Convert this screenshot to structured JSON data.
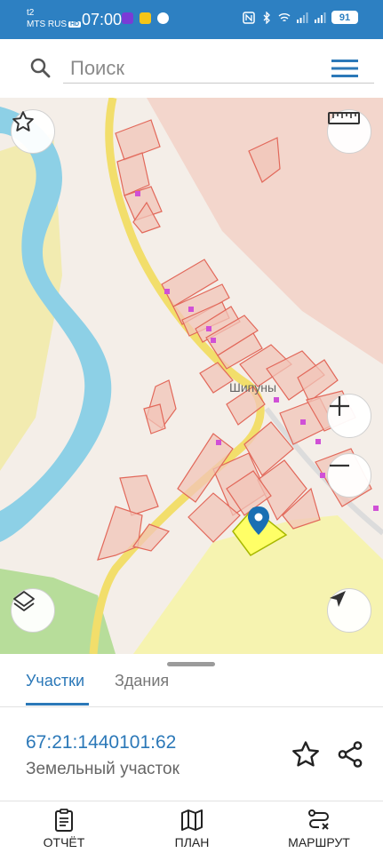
{
  "status_bar": {
    "carrier_top": "t2",
    "carrier_bottom": "MTS RUS",
    "hd_badge": "HD",
    "time": "07:00",
    "battery": "91"
  },
  "search": {
    "placeholder": "Поиск"
  },
  "map": {
    "place_label": "Шипуны",
    "colors": {
      "river": "#8dd0e6",
      "road": "#f2de6b",
      "parcel_fill": "#f2c4b8",
      "parcel_stroke": "#e2685a",
      "selected_fill": "#ffff66",
      "selected_stroke": "#a8b800",
      "pin": "#1a6fb3"
    }
  },
  "tabs": {
    "parcels": "Участки",
    "buildings": "Здания"
  },
  "parcel": {
    "id": "67:21:1440101:62",
    "type": "Земельный участок"
  },
  "bottom_nav": {
    "report": "ОТЧЁТ",
    "plan": "ПЛАН",
    "route": "МАРШРУТ"
  }
}
